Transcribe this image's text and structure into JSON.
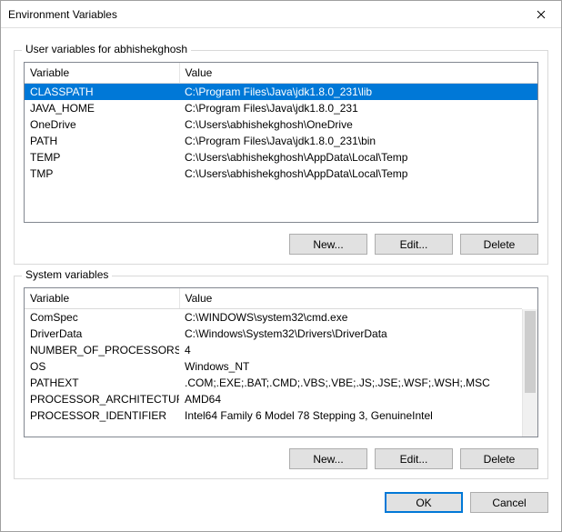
{
  "window": {
    "title": "Environment Variables"
  },
  "user_section": {
    "legend": "User variables for abhishekghosh",
    "headers": {
      "var": "Variable",
      "val": "Value"
    },
    "rows": [
      {
        "name": "CLASSPATH",
        "value": "C:\\Program Files\\Java\\jdk1.8.0_231\\lib",
        "selected": true
      },
      {
        "name": "JAVA_HOME",
        "value": "C:\\Program Files\\Java\\jdk1.8.0_231",
        "selected": false
      },
      {
        "name": "OneDrive",
        "value": "C:\\Users\\abhishekghosh\\OneDrive",
        "selected": false
      },
      {
        "name": "PATH",
        "value": "C:\\Program Files\\Java\\jdk1.8.0_231\\bin",
        "selected": false
      },
      {
        "name": "TEMP",
        "value": "C:\\Users\\abhishekghosh\\AppData\\Local\\Temp",
        "selected": false
      },
      {
        "name": "TMP",
        "value": "C:\\Users\\abhishekghosh\\AppData\\Local\\Temp",
        "selected": false
      }
    ],
    "buttons": {
      "new": "New...",
      "edit": "Edit...",
      "delete": "Delete"
    }
  },
  "system_section": {
    "legend": "System variables",
    "headers": {
      "var": "Variable",
      "val": "Value"
    },
    "rows": [
      {
        "name": "ComSpec",
        "value": "C:\\WINDOWS\\system32\\cmd.exe"
      },
      {
        "name": "DriverData",
        "value": "C:\\Windows\\System32\\Drivers\\DriverData"
      },
      {
        "name": "NUMBER_OF_PROCESSORS",
        "value": "4"
      },
      {
        "name": "OS",
        "value": "Windows_NT"
      },
      {
        "name": "PATHEXT",
        "value": ".COM;.EXE;.BAT;.CMD;.VBS;.VBE;.JS;.JSE;.WSF;.WSH;.MSC"
      },
      {
        "name": "PROCESSOR_ARCHITECTURE",
        "value": "AMD64"
      },
      {
        "name": "PROCESSOR_IDENTIFIER",
        "value": "Intel64 Family 6 Model 78 Stepping 3, GenuineIntel"
      }
    ],
    "buttons": {
      "new": "New...",
      "edit": "Edit...",
      "delete": "Delete"
    }
  },
  "dialog_buttons": {
    "ok": "OK",
    "cancel": "Cancel"
  }
}
